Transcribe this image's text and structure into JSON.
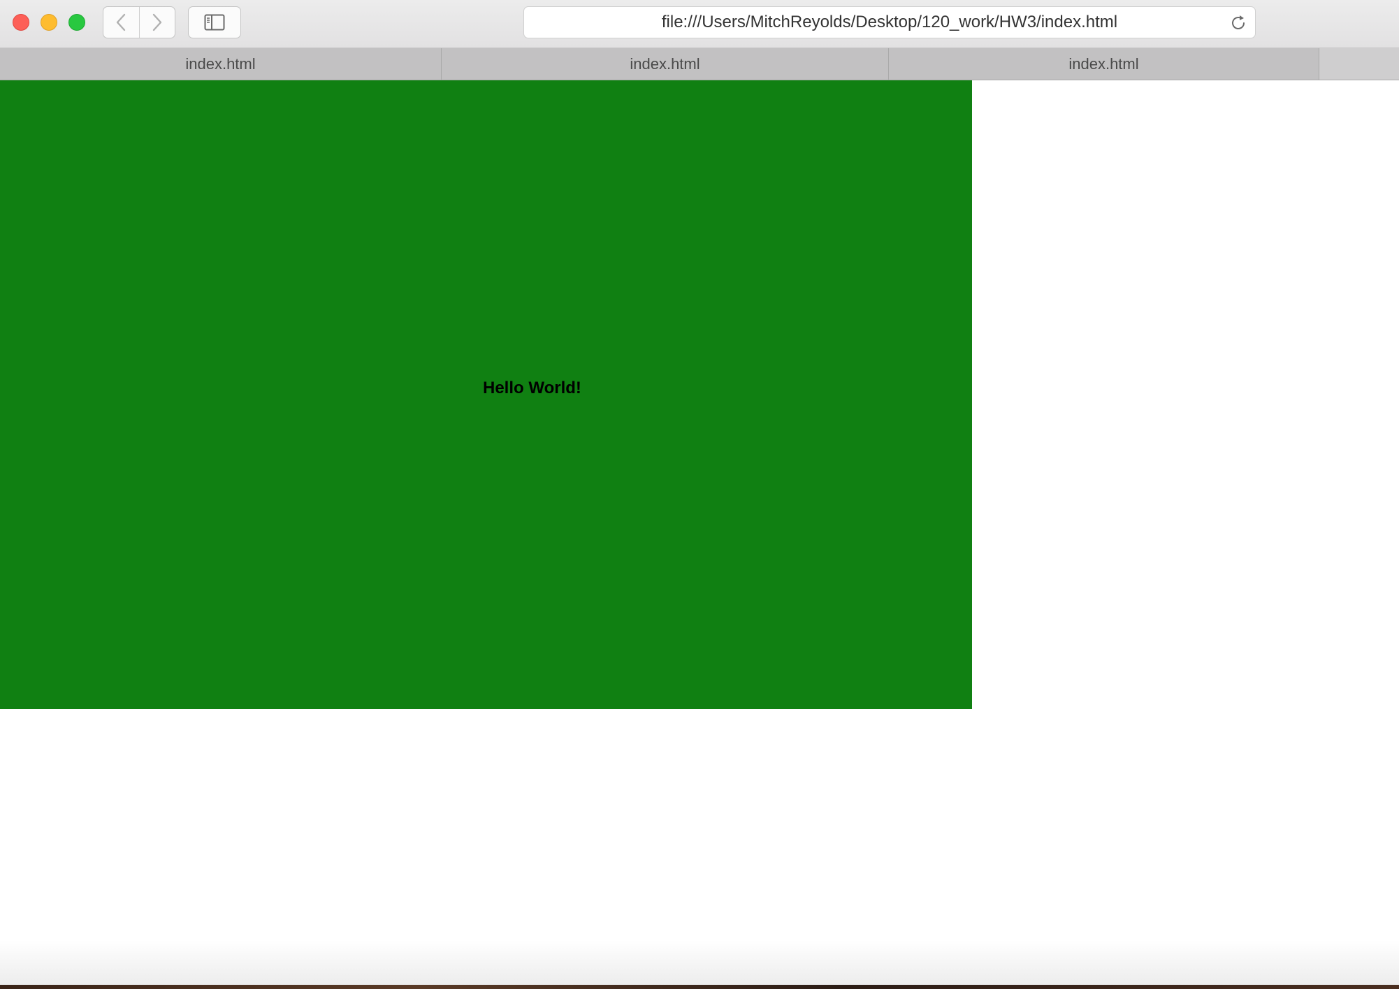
{
  "browser": {
    "address_bar": {
      "url": "file:///Users/MitchReyolds/Desktop/120_work/HW3/index.html"
    },
    "tabs": [
      {
        "label": "index.html"
      },
      {
        "label": "index.html"
      },
      {
        "label": "index.html"
      }
    ],
    "icons": {
      "back": "chevron-left-icon",
      "forward": "chevron-right-icon",
      "sidebar": "sidebar-icon",
      "reload": "reload-icon"
    },
    "traffic_light_colors": {
      "close": "#fd5f57",
      "minimize": "#febc2e",
      "zoom": "#28c840"
    }
  },
  "page": {
    "box_color": "#108012",
    "heading": "Hello World!"
  }
}
